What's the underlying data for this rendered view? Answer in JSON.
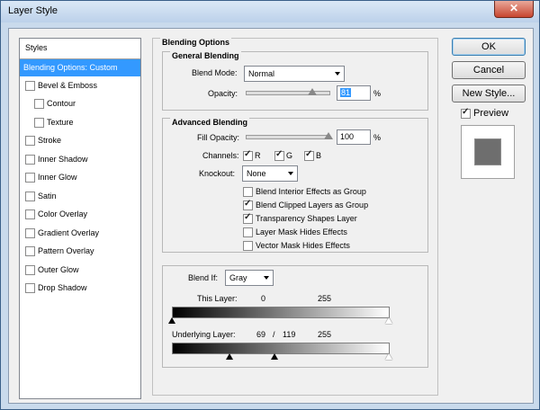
{
  "window": {
    "title": "Layer Style",
    "close_glyph": "✕"
  },
  "styles_panel": {
    "header": "Styles",
    "items": [
      {
        "label": "Blending Options: Custom",
        "selected": true,
        "checkbox": false,
        "checked": false
      },
      {
        "label": "Bevel & Emboss",
        "checkbox": true,
        "checked": false
      },
      {
        "label": "Contour",
        "checkbox": true,
        "checked": false
      },
      {
        "label": "Texture",
        "checkbox": true,
        "checked": false
      },
      {
        "label": "Stroke",
        "checkbox": true,
        "checked": false
      },
      {
        "label": "Inner Shadow",
        "checkbox": true,
        "checked": false
      },
      {
        "label": "Inner Glow",
        "checkbox": true,
        "checked": false
      },
      {
        "label": "Satin",
        "checkbox": true,
        "checked": false
      },
      {
        "label": "Color Overlay",
        "checkbox": true,
        "checked": false
      },
      {
        "label": "Gradient Overlay",
        "checkbox": true,
        "checked": false
      },
      {
        "label": "Pattern Overlay",
        "checkbox": true,
        "checked": false
      },
      {
        "label": "Outer Glow",
        "checkbox": true,
        "checked": false
      },
      {
        "label": "Drop Shadow",
        "checkbox": true,
        "checked": false
      }
    ]
  },
  "blending": {
    "section_title": "Blending Options",
    "general": {
      "title": "General Blending",
      "blend_mode_label": "Blend Mode:",
      "blend_mode_value": "Normal",
      "opacity_label": "Opacity:",
      "opacity_value": "81",
      "opacity_unit": "%"
    },
    "advanced": {
      "title": "Advanced Blending",
      "fill_opacity_label": "Fill Opacity:",
      "fill_opacity_value": "100",
      "fill_opacity_unit": "%",
      "channels_label": "Channels:",
      "channels": [
        {
          "label": "R",
          "checked": true
        },
        {
          "label": "G",
          "checked": true
        },
        {
          "label": "B",
          "checked": true
        }
      ],
      "knockout_label": "Knockout:",
      "knockout_value": "None",
      "options": [
        {
          "label": "Blend Interior Effects as Group",
          "checked": false
        },
        {
          "label": "Blend Clipped Layers as Group",
          "checked": true
        },
        {
          "label": "Transparency Shapes Layer",
          "checked": true
        },
        {
          "label": "Layer Mask Hides Effects",
          "checked": false
        },
        {
          "label": "Vector Mask Hides Effects",
          "checked": false
        }
      ]
    },
    "blend_if": {
      "label": "Blend If:",
      "value": "Gray",
      "this_layer_label": "This Layer:",
      "this_layer_low": "0",
      "this_layer_high": "255",
      "underlying_label": "Underlying Layer:",
      "underlying_low": "69",
      "underlying_sep": "/",
      "underlying_mid": "119",
      "underlying_high": "255"
    }
  },
  "buttons": {
    "ok": "OK",
    "cancel": "Cancel",
    "new_style": "New Style..."
  },
  "preview": {
    "label": "Preview",
    "checked": true
  }
}
